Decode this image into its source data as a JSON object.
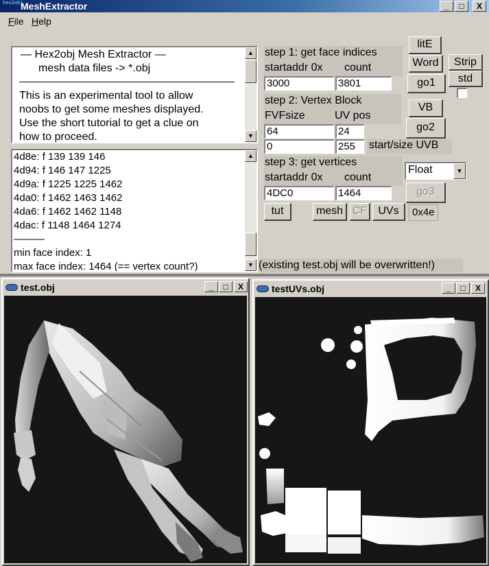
{
  "window": {
    "title": "MeshExtractor",
    "app_icon_text": "hex2obj",
    "buttons": {
      "minimize": "_",
      "maximize": "□",
      "close": "X"
    }
  },
  "menubar": {
    "items": [
      "File",
      "Help"
    ]
  },
  "info_panel": {
    "lines": [
      "—   Hex2obj Mesh Extractor   —",
      "mesh data files -> *.obj",
      "This is an experimental tool to allow",
      "noobs to get some meshes displayed.",
      "Use the short tutorial to get a clue on",
      "how to proceed."
    ]
  },
  "log_panel": {
    "lines": [
      "4d8e: f  139 139 146",
      "4d94: f  146 147 1225",
      "4d9a: f  1225 1225 1462",
      "4da0: f  1462 1463 1462",
      "4da6: f  1462 1462 1148",
      "4dac: f  1148 1464 1274",
      "———",
      "min face index: 1",
      "max face index: 1464 (== vertex count?)"
    ]
  },
  "step1": {
    "label": "step 1: get face indices",
    "startaddr_label": "startaddr 0x",
    "count_label": "count",
    "startaddr_value": "3000",
    "count_value": "3801"
  },
  "step2": {
    "label": "step 2: Vertex Block",
    "fvf_label": "FVFsize",
    "uvpos_label": "UV pos",
    "fvf_value": "64",
    "uvpos_value": "24",
    "uvb_start_value": "0",
    "uvb_size_value": "255",
    "uvb_label": "start/size UVB"
  },
  "step3": {
    "label": "step 3: get vertices",
    "startaddr_label": "startaddr 0x",
    "count_label": "count",
    "startaddr_value": "4DC0",
    "count_value": "1464",
    "format_select": "Float"
  },
  "buttons": {
    "lite": "litE",
    "word": "Word",
    "strip": "Strip",
    "std": "std",
    "go1": "go1",
    "vb": "VB",
    "go2": "go2",
    "go3": "go3",
    "tut": "tut",
    "mesh": "mesh",
    "cf": "CF",
    "uvs": "UVs",
    "hex": "0x4e"
  },
  "status": "(existing test.obj will be overwritten!)",
  "child_windows": {
    "left_title": "test.obj",
    "right_title": "testUVs.obj"
  }
}
